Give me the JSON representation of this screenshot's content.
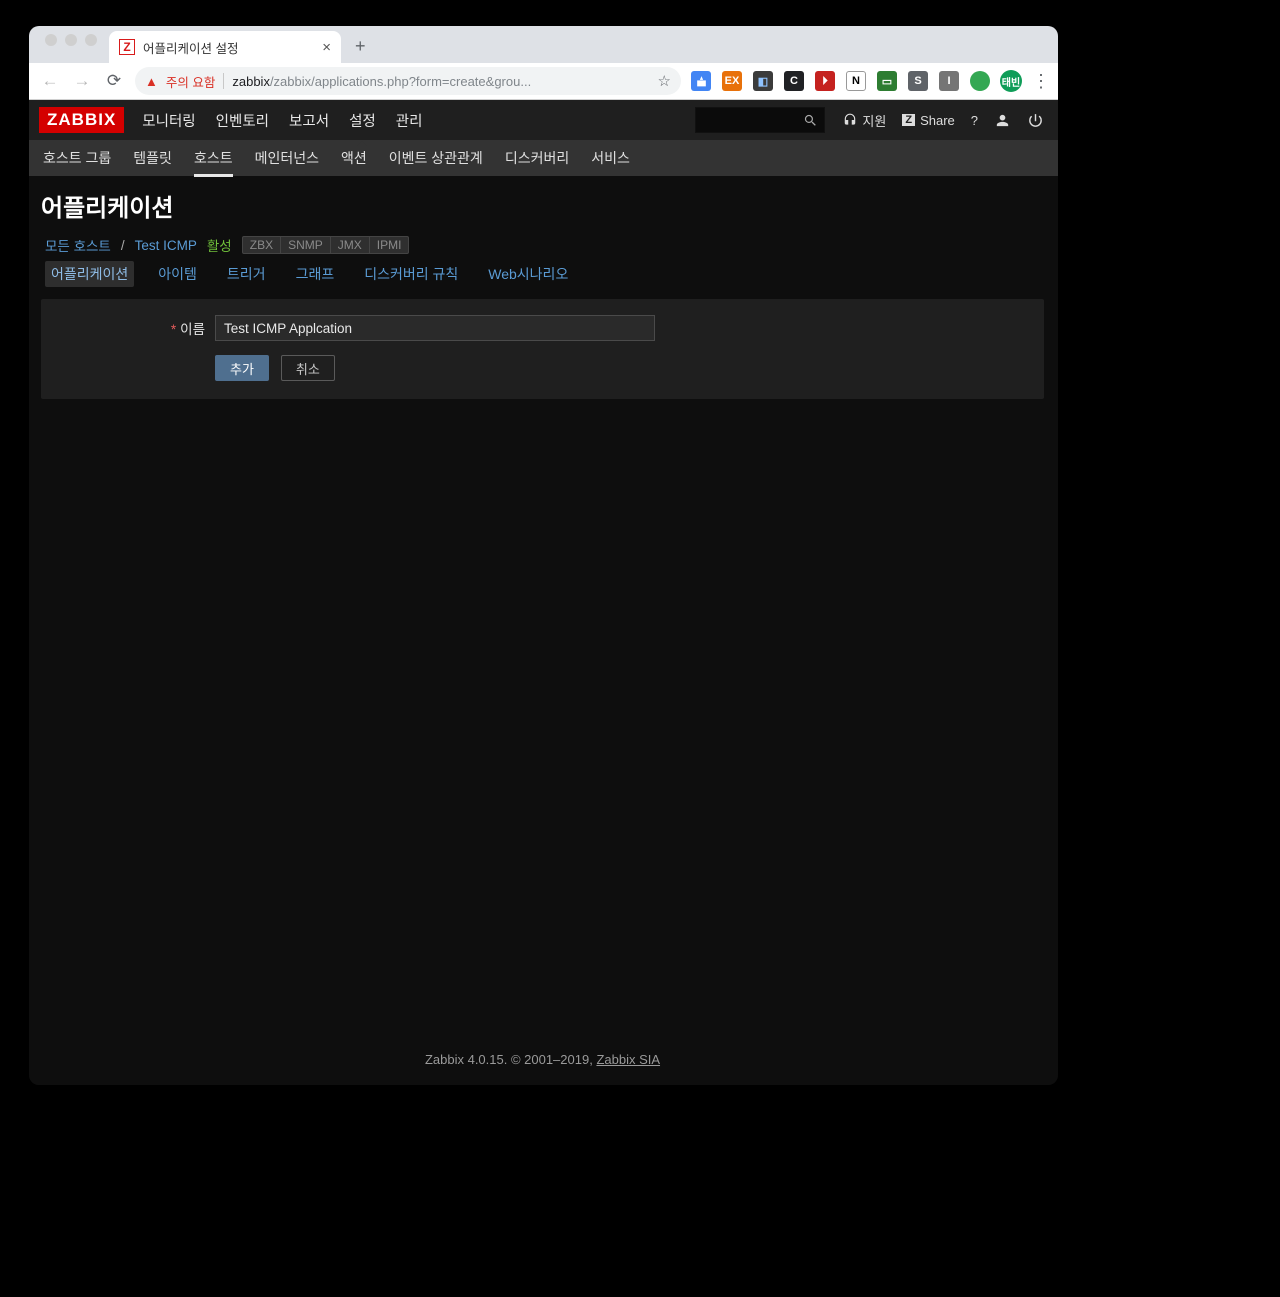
{
  "browser": {
    "tab_title": "어플리케이션 설정",
    "security_warning": "주의 요함",
    "url_host": "zabbix",
    "url_path": "/zabbix/applications.php?form=create&grou...",
    "avatar_label": "태빈"
  },
  "header": {
    "logo": "ZABBIX",
    "menu": [
      "모니터링",
      "인벤토리",
      "보고서",
      "설정",
      "관리"
    ],
    "menu_active_index": 3,
    "support": "지원",
    "share": "Share",
    "help": "?"
  },
  "submenu": {
    "items": [
      "호스트 그룹",
      "템플릿",
      "호스트",
      "메인터넌스",
      "액션",
      "이벤트 상관관계",
      "디스커버리",
      "서비스"
    ],
    "active_index": 2
  },
  "page": {
    "title": "어플리케이션",
    "breadcrumb": {
      "all_hosts": "모든 호스트",
      "host": "Test ICMP",
      "status": "활성",
      "protocols": [
        "ZBX",
        "SNMP",
        "JMX",
        "IPMI"
      ]
    },
    "tabs": {
      "items": [
        "어플리케이션",
        "아이템",
        "트리거",
        "그래프",
        "디스커버리 규칙",
        "Web시나리오"
      ],
      "active_index": 0
    },
    "form": {
      "name_label": "이름",
      "name_value": "Test ICMP Applcation",
      "submit": "추가",
      "cancel": "취소"
    }
  },
  "footer": {
    "text": "Zabbix 4.0.15. © 2001–2019, ",
    "link": "Zabbix SIA"
  }
}
